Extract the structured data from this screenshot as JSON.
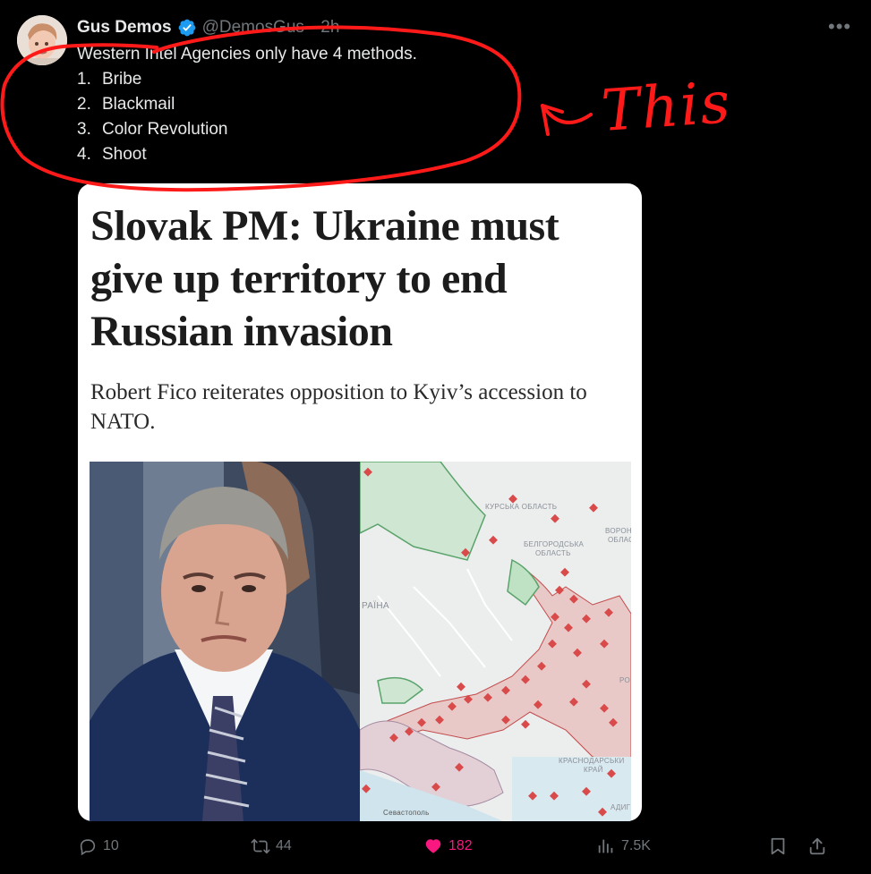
{
  "author": {
    "display_name": "Gus Demos",
    "handle": "@DemosGus",
    "separator": "·",
    "time": "2h",
    "avatar_icon": "user-avatar",
    "verified_icon": "verified-badge-icon"
  },
  "tweet": {
    "intro": "Western Intel Agencies only have 4 methods.",
    "items": [
      {
        "num": "1.",
        "text": "Bribe"
      },
      {
        "num": "2.",
        "text": "Blackmail"
      },
      {
        "num": "3.",
        "text": "Color Revolution"
      },
      {
        "num": "4.",
        "text": "Shoot"
      }
    ]
  },
  "annotation": {
    "text": "This",
    "color": "#ff1a1a"
  },
  "media": {
    "headline": "Slovak PM: Ukraine must give up territory to end Russian invasion",
    "subhead": "Robert Fico reiterates opposition to Kyiv’s accession to NATO.",
    "map_labels": {
      "kursk": "КУРСЬКА ОБЛАСТЬ",
      "belgorod_1": "БЕЛГОРОДСЬКА",
      "belgorod_2": "ОБЛАСТЬ",
      "voronezh_1": "ВОРОНЕ",
      "voronezh_2": "ОБЛАС",
      "ukraine": "РАЇНА",
      "krasnodar_1": "КРАСНОДАРСЬКИ",
      "krasnodar_2": "КРАЙ",
      "sevastopol": "Севастополь",
      "adyg": "АДИГ",
      "ro": "РО"
    }
  },
  "actions": {
    "reply": {
      "count": "10",
      "icon": "reply-icon"
    },
    "retweet": {
      "count": "44",
      "icon": "retweet-icon"
    },
    "like": {
      "count": "182",
      "icon": "heart-icon",
      "color": "#f91880"
    },
    "views": {
      "count": "7.5K",
      "icon": "views-icon"
    },
    "bookmark": {
      "icon": "bookmark-icon"
    },
    "share": {
      "icon": "share-icon"
    }
  }
}
